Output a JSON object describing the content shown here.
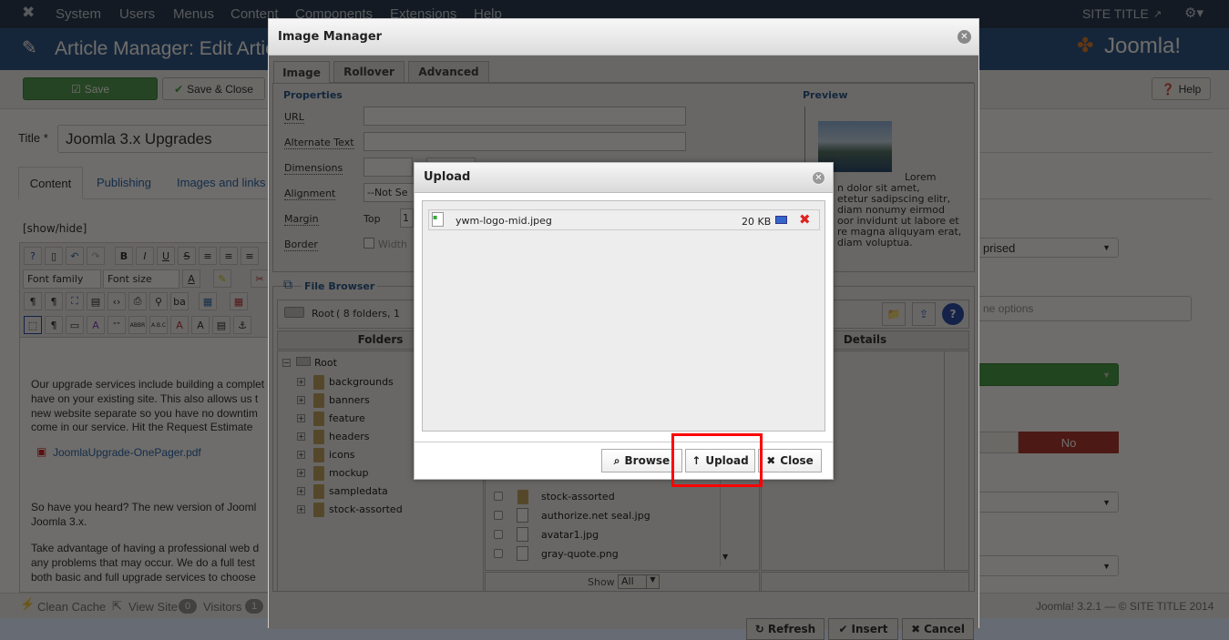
{
  "nav": {
    "menu": [
      "System",
      "Users",
      "Menus",
      "Content",
      "Components",
      "Extensions",
      "Help"
    ],
    "site_title": "SITE TITLE",
    "gear_icon": "gear-icon"
  },
  "header": {
    "title": "Article Manager: Edit Article",
    "logo": "Joomla!"
  },
  "toolbar": {
    "save": "Save",
    "save_close": "Save & Close",
    "help": "Help"
  },
  "article": {
    "title_label": "Title *",
    "title_value": "Joomla 3.x Upgrades",
    "tabs": [
      "Content",
      "Publishing",
      "Images and links"
    ],
    "show_hide": "[show/hide]",
    "font_family": "Font family",
    "font_size": "Font size",
    "paragraphs": [
      "Our upgrade services include building a complet",
      "have on your existing site.  This also allows us t",
      "new website separate so you have no downtim",
      "come in our service.  Hit the Request Estimate"
    ],
    "pdf_link": "JoomlaUpgrade-OnePager.pdf",
    "paragraphs2": [
      "So have you heard? The new version of Jooml",
      "Joomla 3.x."
    ],
    "paragraphs3": [
      "Take advantage of having a professional web d",
      "any problems that may occur. We do a full test",
      "both basic and full upgrade services to choose"
    ]
  },
  "right_panel": {
    "category_value": "prised",
    "tags_placeholder": "ne options",
    "toggle_no": "No",
    "colors": {
      "green": "#46a546",
      "red": "#bd362f"
    }
  },
  "footer": {
    "clean_cache": "Clean Cache",
    "view_site": "View Site",
    "visitors_count": "0",
    "visitors": "Visitors",
    "admin_count": "1",
    "copyright": "Joomla! 3.2.1 — © SITE TITLE 2014"
  },
  "image_manager": {
    "title": "Image Manager",
    "tabs": [
      "Image",
      "Rollover",
      "Advanced"
    ],
    "properties": {
      "legend": "Properties",
      "labels": [
        "URL",
        "Alternate Text",
        "Dimensions",
        "Alignment",
        "Margin",
        "Border"
      ],
      "alignment_value": "--Not Se",
      "margin_top": "Top",
      "margin_top_value": "1",
      "border_width": "Width"
    },
    "preview": {
      "legend": "Preview",
      "text": [
        "Lorem",
        "n dolor sit amet,",
        "etetur sadipscing elitr,",
        "diam nonumy eirmod",
        "oor invidunt ut labore et",
        "re magna aliquyam erat,",
        "diam voluptua."
      ]
    },
    "file_browser": {
      "legend": "File Browser",
      "root": "Root",
      "count": "( 8 folders, 1",
      "folders_header": "Folders",
      "details_header": "Details",
      "tree_root": "Root",
      "folders": [
        "backgrounds",
        "banners",
        "feature",
        "headers",
        "icons",
        "mockup",
        "sampledata",
        "stock-assorted"
      ],
      "files": [
        "stock-assorted",
        "authorize.net seal.jpg",
        "avatar1.jpg",
        "gray-quote.png"
      ],
      "show_label": "Show",
      "show_value": "All"
    },
    "buttons": {
      "refresh": "Refresh",
      "insert": "Insert",
      "cancel": "Cancel"
    }
  },
  "upload": {
    "title": "Upload",
    "queue": [
      {
        "name": "ywm-logo-mid.jpeg",
        "size": "20 KB"
      }
    ],
    "buttons": {
      "browse": "Browse",
      "upload": "Upload",
      "close": "Close"
    },
    "highlight_color": "#ff0000"
  }
}
